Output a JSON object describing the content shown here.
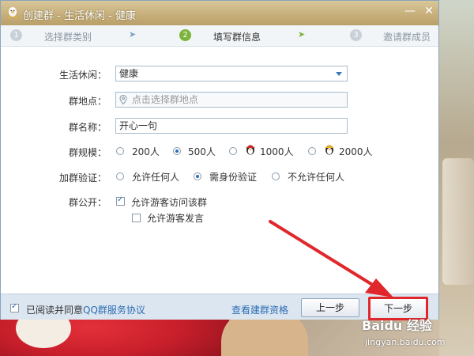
{
  "window": {
    "title": "创建群 - 生活休闲 - 健康",
    "min_symbol": "—",
    "close_symbol": "✕"
  },
  "steps": [
    {
      "num": "1",
      "label": "选择群类别",
      "state": "done"
    },
    {
      "num": "2",
      "label": "填写群信息",
      "state": "active"
    },
    {
      "num": "3",
      "label": "邀请群成员",
      "state": "pending"
    }
  ],
  "step_arrow": "➤",
  "form": {
    "category": {
      "label": "生活休闲：",
      "value": "健康"
    },
    "location": {
      "label": "群地点：",
      "placeholder": "点击选择群地点"
    },
    "name": {
      "label": "群名称：",
      "value": "开心一句"
    },
    "size": {
      "label": "群规模：",
      "options": [
        "200人",
        "500人",
        "1000人",
        "2000人"
      ],
      "selected": "500人"
    },
    "verify": {
      "label": "加群验证：",
      "options": [
        "允许任何人",
        "需身份验证",
        "不允许任何人"
      ],
      "selected": "需身份验证"
    },
    "public": {
      "label": "群公开：",
      "opt1": "允许游客访问该群",
      "opt1_checked": true,
      "opt2": "允许游客发言",
      "opt2_checked": false
    }
  },
  "footer": {
    "agree_prefix": "已阅读并同意",
    "agree_link": "QQ群服务协议",
    "agree_checked": true,
    "view_link": "查看建群资格",
    "prev_button": "上一步",
    "next_button": "下一步"
  },
  "watermark": {
    "brand": "Baidu 经验",
    "url": "jingyan.baidu.com"
  },
  "colors": {
    "accent_red": "#e0282c",
    "link_blue": "#2d6db5",
    "step_active_green": "#7bb43a"
  }
}
